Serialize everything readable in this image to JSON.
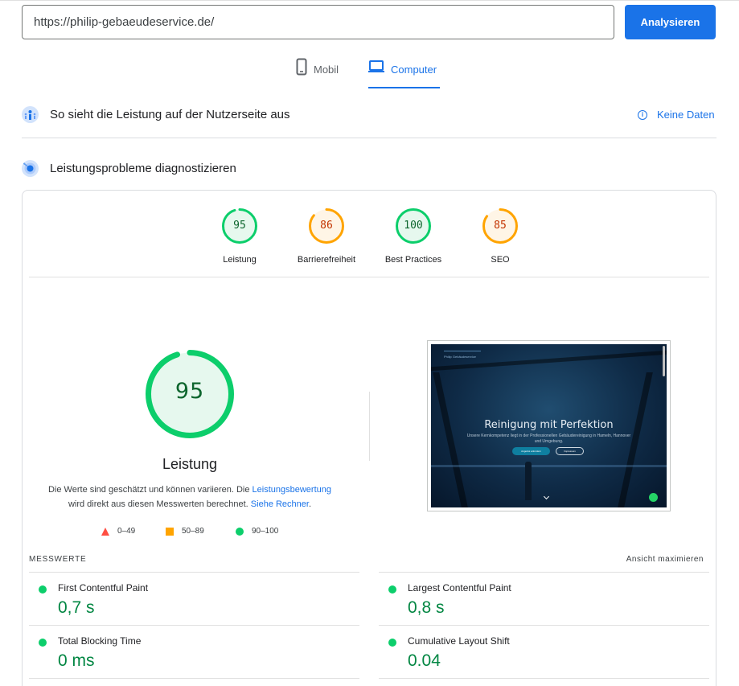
{
  "search": {
    "url_value": "https://philip-gebaeudeservice.de/",
    "analyze_label": "Analysieren"
  },
  "tabs": [
    {
      "label": "Mobil",
      "icon": "smartphone-icon",
      "active": false
    },
    {
      "label": "Computer",
      "icon": "laptop-icon",
      "active": true
    }
  ],
  "field_section": {
    "title": "So sieht die Leistung auf der Nutzerseite aus",
    "no_data_label": "Keine Daten"
  },
  "lab_section": {
    "title": "Leistungsprobleme diagnostizieren"
  },
  "scores": [
    {
      "label": "Leistung",
      "value": 95,
      "status": "good"
    },
    {
      "label": "Barrierefreiheit",
      "value": 86,
      "status": "average"
    },
    {
      "label": "Best Practices",
      "value": 100,
      "status": "good"
    },
    {
      "label": "SEO",
      "value": 85,
      "status": "average"
    }
  ],
  "main_gauge": {
    "value": 95,
    "title": "Leistung",
    "desc_1": "Die Werte sind geschätzt und können variieren. Die ",
    "link_1": "Leistungsbewertung",
    "desc_2": "wird direkt aus diesen Messwerten berechnet. ",
    "link_2": "Siehe Rechner",
    "desc_3": "."
  },
  "legend": [
    {
      "label": "0–49",
      "shape": "triangle",
      "color": "#ff4e42"
    },
    {
      "label": "50–89",
      "shape": "square",
      "color": "#ffa400"
    },
    {
      "label": "90–100",
      "shape": "circle",
      "color": "#0cce6b"
    }
  ],
  "thumbnail": {
    "headline": "Reinigung mit Perfektion",
    "subline": "Unsere Kernkompetenz liegt in der Professionellen Gebäudereinigung in Hameln, Hannover und Umgebung.",
    "btn_primary": "Angebot anfordern",
    "btn_secondary": "Impressum",
    "logo_text": "Philip Gebäudeservice"
  },
  "metrics": {
    "title": "MESSWERTE",
    "expand_label": "Ansicht maximieren",
    "items": [
      {
        "name": "First Contentful Paint",
        "value": "0,7 s"
      },
      {
        "name": "Largest Contentful Paint",
        "value": "0,8 s"
      },
      {
        "name": "Total Blocking Time",
        "value": "0 ms"
      },
      {
        "name": "Cumulative Layout Shift",
        "value": "0.04"
      }
    ]
  },
  "colors": {
    "accent": "#1a73e8",
    "good": "#0cce6b",
    "good_text": "#018642",
    "average": "#ffa400",
    "average_text": "#c33300",
    "poor": "#ff4e42"
  }
}
